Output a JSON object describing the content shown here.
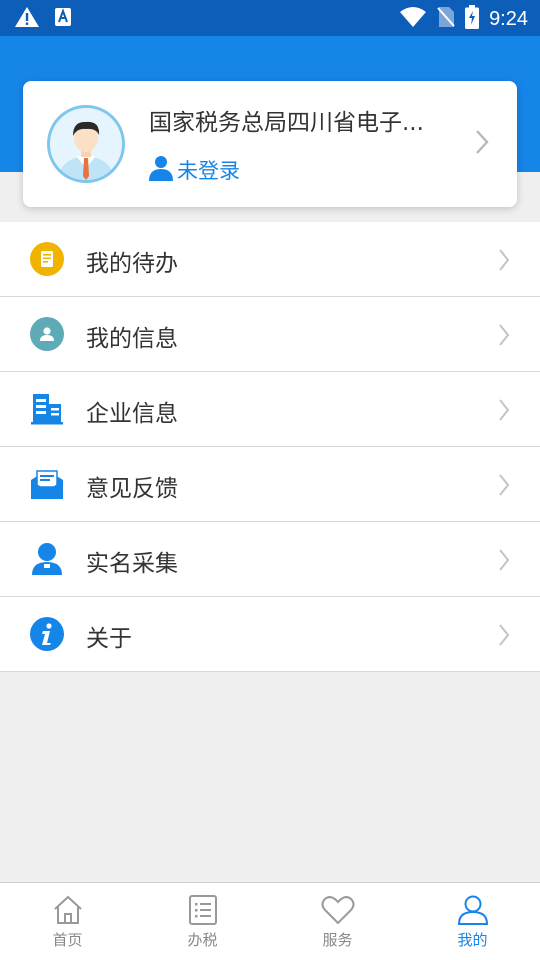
{
  "status_bar": {
    "time": "9:24",
    "icons": [
      "warning-icon",
      "a-app-icon",
      "wifi-icon",
      "no-sim-icon",
      "battery-charging-icon"
    ]
  },
  "profile": {
    "org_name": "国家税务总局四川省电子...",
    "login_status": "未登录"
  },
  "menu": {
    "items": [
      {
        "label": "我的待办",
        "icon": "todo-icon",
        "color": "#f0b400"
      },
      {
        "label": "我的信息",
        "icon": "user-info-icon",
        "color": "#5eaab6"
      },
      {
        "label": "企业信息",
        "icon": "building-icon",
        "color": "#1685e8"
      },
      {
        "label": "意见反馈",
        "icon": "feedback-mail-icon",
        "color": "#1685e8"
      },
      {
        "label": "实名采集",
        "icon": "person-icon",
        "color": "#1685e8"
      },
      {
        "label": "关于",
        "icon": "info-icon",
        "color": "#1685e8"
      }
    ]
  },
  "bottom_nav": {
    "items": [
      {
        "label": "首页",
        "icon": "home-icon"
      },
      {
        "label": "办税",
        "icon": "list-icon"
      },
      {
        "label": "服务",
        "icon": "heart-icon"
      },
      {
        "label": "我的",
        "icon": "profile-icon",
        "active": true
      }
    ]
  },
  "colors": {
    "status_bar": "#0d5eb8",
    "accent": "#1685e8",
    "background": "#efefef"
  }
}
